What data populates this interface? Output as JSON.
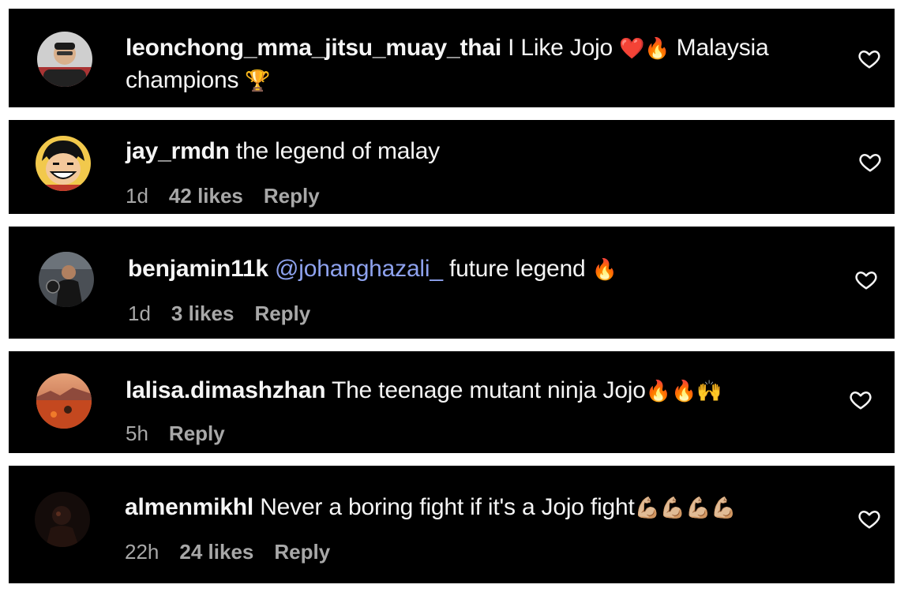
{
  "colors": {
    "background": "#ffffff",
    "card": "#000000",
    "text": "#f5f5f5",
    "meta": "#a8a8a8",
    "mention": "#8ea2ee"
  },
  "comments": [
    {
      "username": "leonchong_mma_jitsu_muay_thai",
      "text_before": " I Like Jojo ",
      "emoji_1": "❤️🔥",
      "text_mid": " Malaysia",
      "text_line2": "champions ",
      "emoji_2": "🏆",
      "like_icon": "heart-outline-icon"
    },
    {
      "username": "jay_rmdn",
      "text": " the legend of malay",
      "time": "1d",
      "likes": "42 likes",
      "reply": "Reply",
      "like_icon": "heart-outline-icon"
    },
    {
      "username": "benjamin11k",
      "mention": "@johanghazali_",
      "text": " future legend ",
      "emoji": "🔥",
      "time": "1d",
      "likes": "3 likes",
      "reply": "Reply",
      "like_icon": "heart-outline-icon"
    },
    {
      "username": "lalisa.dimashzhan",
      "text": " The teenage mutant ninja Jojo",
      "emoji": "🔥🔥🙌",
      "time": "5h",
      "reply": "Reply",
      "like_icon": "heart-outline-icon"
    },
    {
      "username": "almenmikhl",
      "text": " Never a boring fight if it's a Jojo fight",
      "emoji": "💪🏼💪🏼💪🏼💪🏼",
      "time": "22h",
      "likes": "24 likes",
      "reply": "Reply",
      "like_icon": "heart-outline-icon"
    }
  ]
}
